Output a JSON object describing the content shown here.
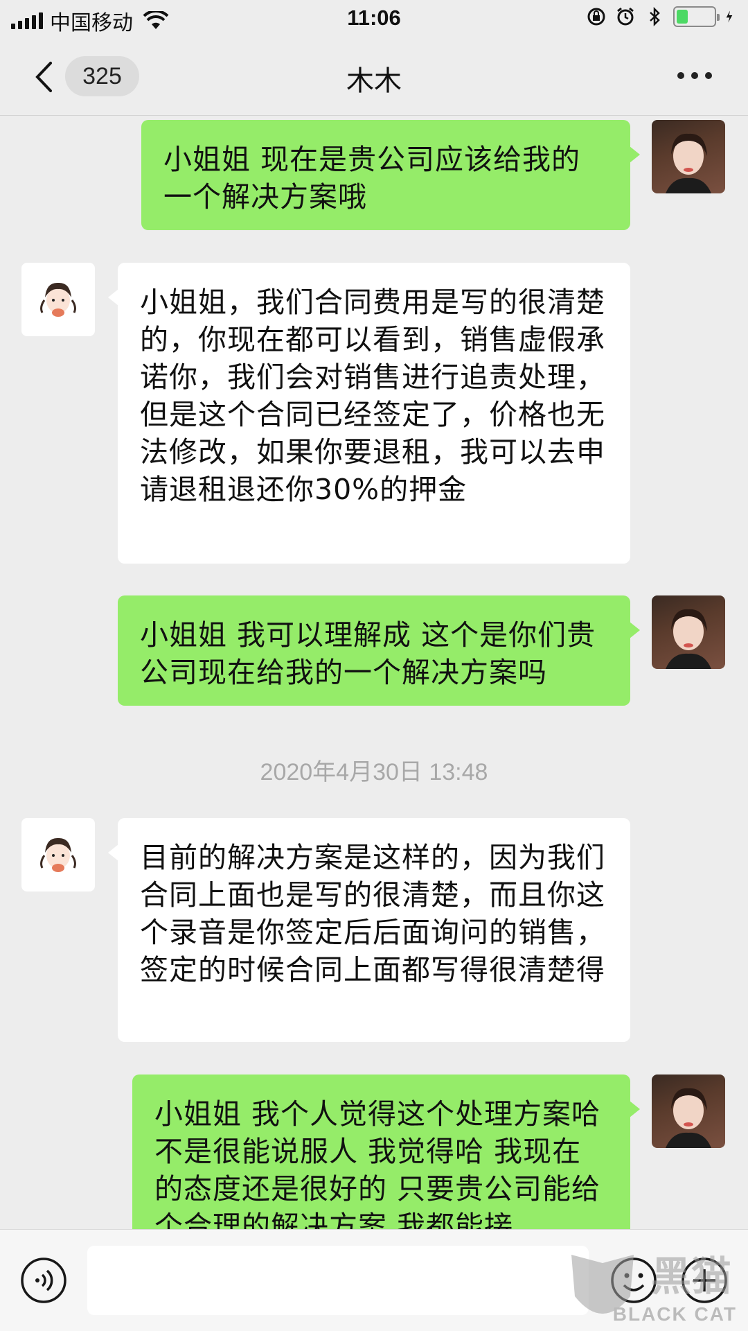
{
  "status_bar": {
    "carrier": "中国移动",
    "time": "11:06",
    "battery_level": 0.3
  },
  "nav": {
    "unread_count": "325",
    "title": "木木"
  },
  "messages": [
    {
      "sender": "self",
      "text": "小姐姐 现在是贵公司应该给我的一个解决方案哦"
    },
    {
      "sender": "other",
      "text": "小姐姐，我们合同费用是写的很清楚的，你现在都可以看到，销售虚假承诺你，我们会对销售进行追责处理，但是这个合同已经签定了，价格也无法修改，如果你要退租，我可以去申请退租退还你30%的押金"
    },
    {
      "sender": "self",
      "text": "小姐姐 我可以理解成 这个是你们贵公司现在给我的一个解决方案吗"
    },
    {
      "sender": "other",
      "text": "目前的解决方案是这样的，因为我们合同上面也是写的很清楚，而且你这个录音是你签定后后面询问的销售，签定的时候合同上面都写得很清楚得"
    },
    {
      "sender": "self",
      "text": "小姐姐 我个人觉得这个处理方案哈不是很能说服人 我觉得哈 我现在的态度还是很好的 只要贵公司能给个合理的解决方案 我都能接"
    }
  ],
  "timestamp": "2020年4月30日 13:48",
  "watermark": {
    "cn": "黑猫",
    "en": "BLACK CAT"
  },
  "colors": {
    "self_bubble": "#95ec69",
    "other_bubble": "#ffffff",
    "background": "#ededed"
  }
}
